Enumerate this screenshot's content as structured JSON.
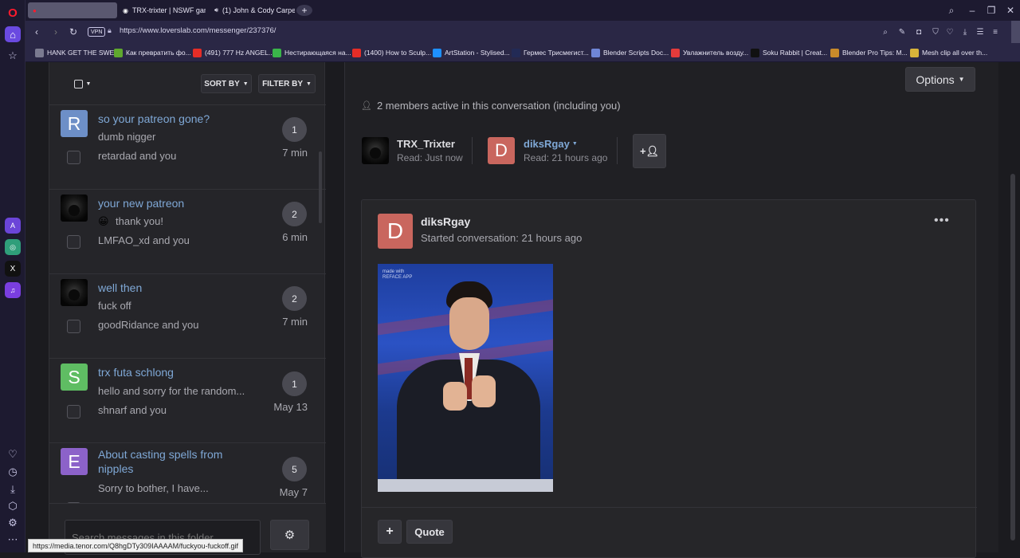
{
  "browser": {
    "tabs": [
      {
        "label": ""
      },
      {
        "label": "TRX-trixter | NSWF game"
      },
      {
        "label": "(1) John & Cody Carpe"
      }
    ],
    "url": "https://www.loverslab.com/messenger/237376/",
    "vpn_label": "VPN",
    "bookmarks": [
      {
        "label": "HANK GET THE SWE...",
        "color": "#7a7a90"
      },
      {
        "label": "Как превратить фо...",
        "color": "#5fa82e"
      },
      {
        "label": "(491) 777 Hz ANGEL...",
        "color": "#e52d27"
      },
      {
        "label": "Нестирающаяся на...",
        "color": "#3ab54a"
      },
      {
        "label": "(1400) How to Sculp...",
        "color": "#e52d27"
      },
      {
        "label": "ArtStation - Stylised...",
        "color": "#1e90ff"
      },
      {
        "label": "Гермес Трисмегист...",
        "color": "#222a55"
      },
      {
        "label": "Blender Scripts Doc...",
        "color": "#6f86d6"
      },
      {
        "label": "Увлажнитель возду...",
        "color": "#e33b3b"
      },
      {
        "label": "Soku Rabbit | Creat...",
        "color": "#111111"
      },
      {
        "label": "Blender Pro Tips: M...",
        "color": "#c98a2a"
      },
      {
        "label": "Mesh clip all over th...",
        "color": "#d8b43a"
      }
    ],
    "status_url": "https://media.tenor.com/Q8hgDTy309IAAAAM/fuckyou-fuckoff.gif"
  },
  "list": {
    "sort_label": "SORT BY",
    "filter_label": "FILTER BY",
    "search_placeholder": "Search messages in this folder",
    "conversations": [
      {
        "title": "so your patreon gone?",
        "snippet": "dumb nigger",
        "participants": "retardad and you",
        "count": "1",
        "time": "7 min",
        "avatar_letter": "R",
        "avatar_color": "#6d8fc7"
      },
      {
        "title": "your new patreon",
        "snippet": "thank you!",
        "participants": "LMFAO_xd and you",
        "count": "2",
        "time": "6 min",
        "avatar_letter": "",
        "avatar_color": "#000000"
      },
      {
        "title": "well then",
        "snippet": "fuck off",
        "participants": "goodRidance and you",
        "count": "2",
        "time": "7 min",
        "avatar_letter": "",
        "avatar_color": "#000000"
      },
      {
        "title": "trx futa schlong",
        "snippet": "hello and sorry for the random...",
        "participants": "shnarf and you",
        "count": "1",
        "time": "May 13",
        "avatar_letter": "S",
        "avatar_color": "#5fbd63"
      },
      {
        "title": "About casting spells from nipples",
        "snippet": "Sorry to bother, I have...",
        "participants": "",
        "count": "5",
        "time": "May 7",
        "avatar_letter": "E",
        "avatar_color": "#8c62c9"
      }
    ]
  },
  "conversation": {
    "options_label": "Options",
    "members_text": "2 members active in this conversation (including you)",
    "members": [
      {
        "name": "TRX_Trixter",
        "status": "Read: Just now"
      },
      {
        "name": "diksRgay",
        "status": "Read: 21 hours ago",
        "avatar_letter": "D",
        "avatar_color": "#c9665e"
      }
    ],
    "message": {
      "author": "diksRgay",
      "meta": "Started conversation: 21 hours ago",
      "avatar_letter": "D",
      "avatar_color": "#c9665e",
      "gif_watermark": "made with REFACE APP",
      "quote_label": "Quote"
    }
  }
}
